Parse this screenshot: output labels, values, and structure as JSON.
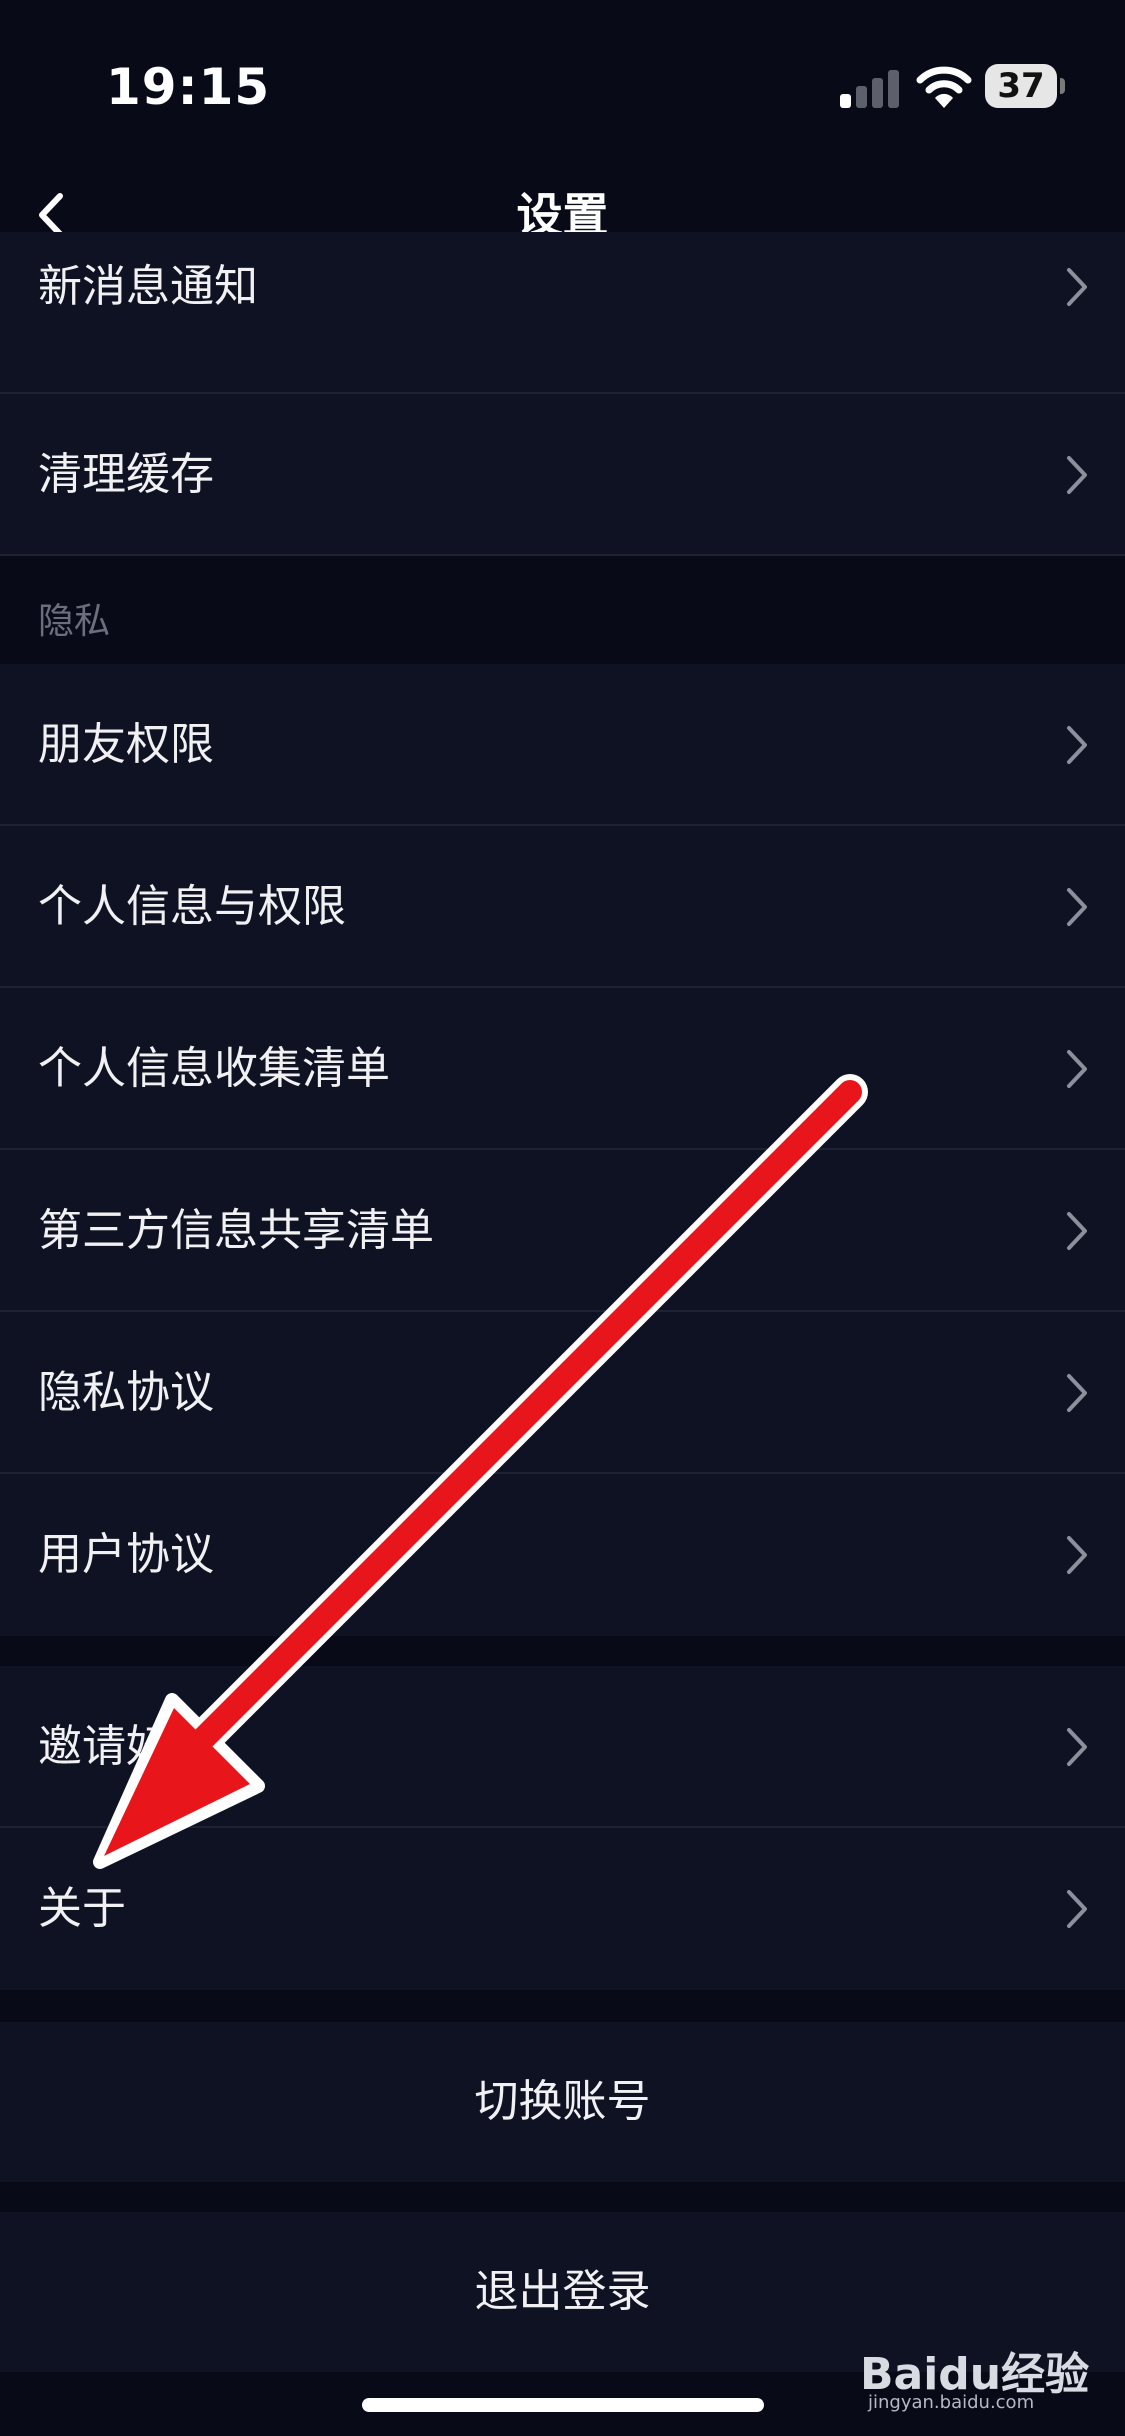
{
  "status_bar": {
    "time": "19:15",
    "battery": "37",
    "icons": [
      "signal-icon",
      "wifi-icon",
      "battery-icon"
    ]
  },
  "nav": {
    "title": "设置",
    "back_icon": "chevron-left-icon"
  },
  "group_top": [
    {
      "label": "新消息通知"
    },
    {
      "label": "清理缓存"
    }
  ],
  "privacy": {
    "section_label": "隐私",
    "items": [
      {
        "label": "朋友权限"
      },
      {
        "label": "个人信息与权限"
      },
      {
        "label": "个人信息收集清单"
      },
      {
        "label": "第三方信息共享清单"
      },
      {
        "label": "隐私协议"
      },
      {
        "label": "用户协议"
      }
    ]
  },
  "group_more": [
    {
      "label": "邀请好友"
    },
    {
      "label": "关于"
    }
  ],
  "actions": {
    "switch_account": "切换账号",
    "logout": "退出登录"
  },
  "watermark": {
    "text": "Baidu经验",
    "sub": "jingyan.baidu.com"
  },
  "colors": {
    "background": "#080a18",
    "row": "#0f1222",
    "annotation_arrow": "#e8161b"
  }
}
